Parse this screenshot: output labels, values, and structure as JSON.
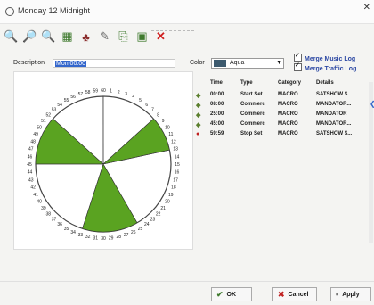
{
  "window": {
    "title": "Monday 12 Midnight"
  },
  "toolbar": {
    "icons": [
      "zoom-in-icon",
      "zoom-out-icon",
      "zoom-reset-icon",
      "grid-icon",
      "stamp-icon",
      "edit-icon",
      "export-icon",
      "page-icon",
      "delete-icon"
    ]
  },
  "form": {
    "description_label": "Description",
    "description_value": "Mon 00:00",
    "color_label": "Color",
    "color_value": "Aqua",
    "color_swatch": "#3c5a6e",
    "merge_music_label": "Merge Music Log",
    "merge_traffic_label": "Merge Traffic Log"
  },
  "clock": {
    "segment_color": "#5aa321",
    "minutes": [
      "1",
      "2",
      "3",
      "4",
      "5",
      "6",
      "7",
      "8",
      "9",
      "10",
      "11",
      "12",
      "13",
      "14",
      "15",
      "16",
      "17",
      "18",
      "19",
      "20",
      "21",
      "22",
      "23",
      "24",
      "25",
      "26",
      "27",
      "28",
      "29",
      "30",
      "31",
      "32",
      "33",
      "34",
      "35",
      "36",
      "37",
      "38",
      "39",
      "40",
      "41",
      "42",
      "43",
      "44",
      "45",
      "46",
      "47",
      "48",
      "49",
      "50",
      "51",
      "52",
      "53",
      "54",
      "55",
      "56",
      "57",
      "58",
      "59",
      "60"
    ]
  },
  "events": {
    "headers": {
      "time": "Time",
      "type": "Type",
      "category": "Category",
      "details": "Details"
    },
    "rows": [
      {
        "time": "00:00",
        "type": "Start Set",
        "category": "MACRO",
        "details": "SATSHOW $..."
      },
      {
        "time": "08:00",
        "type": "Commerc",
        "category": "MACRO",
        "details": "MANDATOR..."
      },
      {
        "time": "25:00",
        "type": "Commerc",
        "category": "MACRO",
        "details": "MANDATOR"
      },
      {
        "time": "45:00",
        "type": "Commerc",
        "category": "MACRO",
        "details": "MANDATOR..."
      },
      {
        "time": "59:59",
        "type": "Stop Set",
        "category": "MACRO",
        "details": "SATSHOW $..."
      }
    ]
  },
  "buttons": {
    "ok": "OK",
    "cancel": "Cancel",
    "apply": "Apply"
  }
}
